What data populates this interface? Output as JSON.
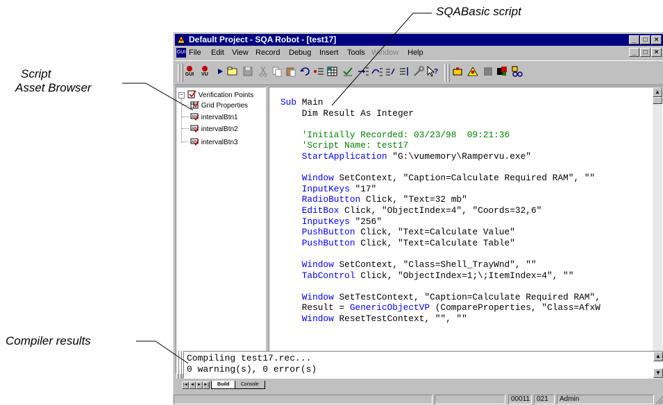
{
  "callouts": {
    "sqabasic": "SQABasic script",
    "asset_line1": "Script",
    "asset_line2": "Asset Browser",
    "compiler": "Compiler results"
  },
  "window": {
    "title": "Default Project - SQA Robot - [test17]",
    "caption_min": "_",
    "caption_max": "□",
    "caption_close": "×"
  },
  "menu": {
    "app_icon": "GUI",
    "items": [
      "File",
      "Edit",
      "View",
      "Record",
      "Debug",
      "Insert",
      "Tools",
      "Window",
      "Help"
    ]
  },
  "toolbar": {
    "gui_label": "GUI",
    "vu_label": "VU"
  },
  "tree": {
    "root": "Verification Points",
    "items": [
      "Grid Properties",
      "intervalBtn1",
      "intervalBtn2",
      "intervalBtn3"
    ]
  },
  "script": {
    "lines": [
      {
        "kw": "Sub",
        "text": " Main"
      },
      {
        "kw": "",
        "text": "    Dim Result As Integer"
      },
      {
        "kw": "",
        "text": ""
      },
      {
        "cm": "    'Initially Recorded: 03/23/98  09:21:36"
      },
      {
        "cm": "    'Script Name: test17"
      },
      {
        "kw": "    StartApplication",
        "text": " \"G:\\vumemory\\Rampervu.exe\""
      },
      {
        "kw": "",
        "text": ""
      },
      {
        "kw": "    Window",
        "text": " SetContext, \"Caption=Calculate Required RAM\", \"\""
      },
      {
        "kw": "    InputKeys",
        "text": " \"17\""
      },
      {
        "kw": "    RadioButton",
        "text": " Click, \"Text=32 mb\""
      },
      {
        "kw": "    EditBox",
        "text": " Click, \"ObjectIndex=4\", \"Coords=32,6\""
      },
      {
        "kw": "    InputKeys",
        "text": " \"256\""
      },
      {
        "kw": "    PushButton",
        "text": " Click, \"Text=Calculate Value\""
      },
      {
        "kw": "    PushButton",
        "text": " Click, \"Text=Calculate Table\""
      },
      {
        "kw": "",
        "text": ""
      },
      {
        "kw": "    Window",
        "text": " SetContext, \"Class=Shell_TrayWnd\", \"\""
      },
      {
        "kw": "    TabControl",
        "text": " Click, \"ObjectIndex=1;\\;ItemIndex=4\", \"\""
      },
      {
        "kw": "",
        "text": ""
      },
      {
        "kw": "    Window",
        "text": " SetTestContext, \"Caption=Calculate Required RAM\","
      },
      {
        "pre": "    Result = ",
        "kw": "GenericObjectVP",
        "text": " (CompareProperties, \"Class=AfxW"
      },
      {
        "kw": "    Window",
        "text": " ResetTestContext, \"\", \"\""
      }
    ]
  },
  "output": {
    "line1": "Compiling test17.rec...",
    "line2": "0 warning(s), 0 error(s)"
  },
  "tabs": {
    "build": "Build",
    "console": "Console"
  },
  "status": {
    "line": "00011",
    "col": "021",
    "user": "Admin"
  }
}
